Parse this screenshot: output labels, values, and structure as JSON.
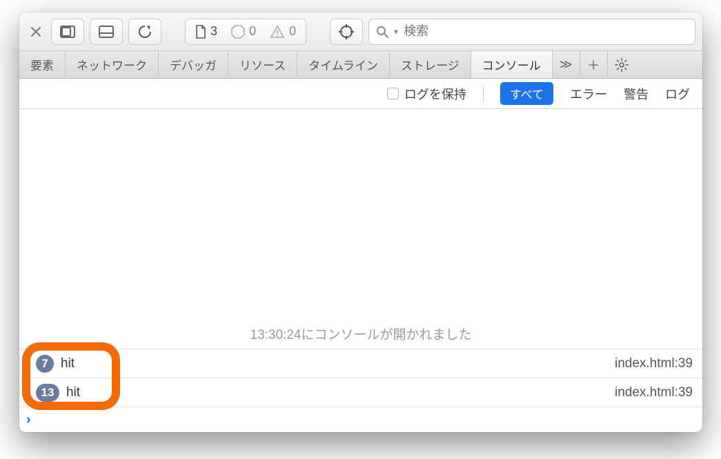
{
  "toolbar": {
    "resource_count": "3",
    "error_count": "0",
    "warning_count": "0",
    "search_placeholder": "検索"
  },
  "tabs": {
    "items": [
      {
        "label": "要素"
      },
      {
        "label": "ネットワーク"
      },
      {
        "label": "デバッガ"
      },
      {
        "label": "リソース"
      },
      {
        "label": "タイムライン"
      },
      {
        "label": "ストレージ"
      },
      {
        "label": "コンソール"
      }
    ],
    "overflow": "≫",
    "add": "＋"
  },
  "filter": {
    "preserve_log": "ログを保持",
    "all": "すべて",
    "errors": "エラー",
    "warnings": "警告",
    "logs": "ログ"
  },
  "console": {
    "opened_message": "13:30:24にコンソールが開かれました",
    "rows": [
      {
        "count": "7",
        "text": "hit",
        "source": "index.html:39"
      },
      {
        "count": "13",
        "text": "hit",
        "source": "index.html:39"
      }
    ]
  }
}
